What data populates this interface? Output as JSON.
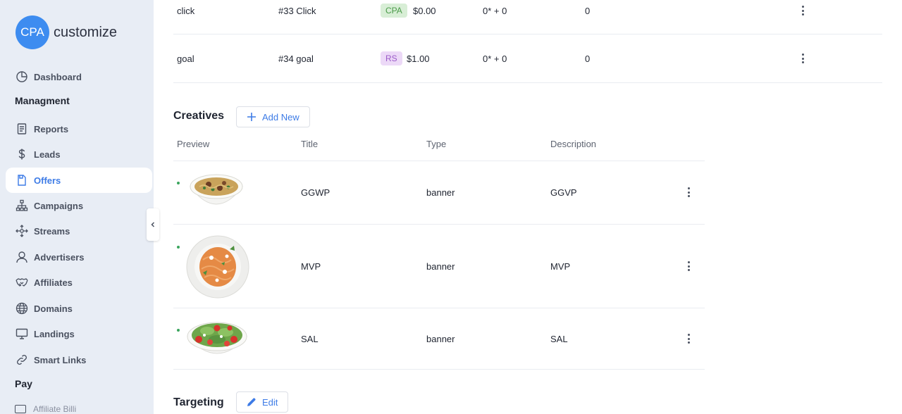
{
  "brand": {
    "badge": "CPA",
    "name": "customize",
    "accent": "#3d8cf0"
  },
  "sidebar": {
    "items": [
      {
        "label": "Dashboard",
        "icon": "pie-chart-icon"
      },
      {
        "label": "Reports",
        "icon": "report-icon"
      },
      {
        "label": "Leads",
        "icon": "dollar-icon"
      },
      {
        "label": "Offers",
        "icon": "offer-doc-icon",
        "active": true
      },
      {
        "label": "Campaigns",
        "icon": "hierarchy-icon"
      },
      {
        "label": "Streams",
        "icon": "streams-icon"
      },
      {
        "label": "Advertisers",
        "icon": "user-icon"
      },
      {
        "label": "Affiliates",
        "icon": "handshake-icon"
      },
      {
        "label": "Domains",
        "icon": "globe-icon"
      },
      {
        "label": "Landings",
        "icon": "monitor-icon"
      },
      {
        "label": "Smart Links",
        "icon": "link-icon"
      }
    ],
    "sections": {
      "management": "Managment",
      "pay": "Pay"
    },
    "cut_item": "Affiliate Billi"
  },
  "goals": {
    "rows": [
      {
        "name": "click",
        "id": "#33 Click",
        "type": "CPA",
        "price": "$0.00",
        "formula": "0* + 0",
        "count": "0"
      },
      {
        "name": "goal",
        "id": "#34 goal",
        "type": "RS",
        "price": "$1.00",
        "formula": "0* + 0",
        "count": "0"
      }
    ]
  },
  "creatives": {
    "title": "Creatives",
    "add_label": "Add New",
    "headers": [
      "Preview",
      "Title",
      "Type",
      "Description"
    ],
    "rows": [
      {
        "preview": "noodle-bowl-image",
        "title": "GGWP",
        "type": "banner",
        "description": "GGVP"
      },
      {
        "preview": "pasta-plate-image",
        "title": "MVP",
        "type": "banner",
        "description": "MVP"
      },
      {
        "preview": "salad-bowl-image",
        "title": "SAL",
        "type": "banner",
        "description": "SAL"
      }
    ]
  },
  "targeting": {
    "title": "Targeting",
    "edit_label": "Edit"
  }
}
